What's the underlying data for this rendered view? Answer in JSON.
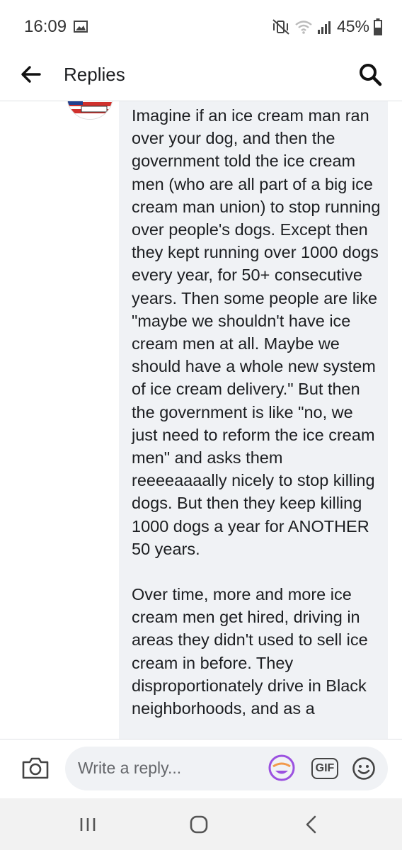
{
  "status_bar": {
    "time": "16:09",
    "battery": "45%",
    "icons": [
      "gallery-icon",
      "mute-vibrate-icon",
      "wifi-icon",
      "signal-icon",
      "battery-icon"
    ]
  },
  "header": {
    "title": "Replies",
    "back_icon": "arrow-left-icon",
    "search_icon": "search-icon"
  },
  "comment": {
    "paragraphs": [
      "Imagine if an ice cream man ran over your dog, and then the government told the ice cream men (who are all part of a big ice cream man union) to stop running over people's dogs. Except then they kept running over 1000 dogs every year, for 50+ consecutive years. Then some people are like \"maybe we shouldn't have ice cream men at all. Maybe we should have a whole new system of ice cream delivery.\" But then the government is like \"no, we just need to reform the ice cream men\" and asks them reeeeaaaally nicely to stop killing dogs. But then they keep killing 1000 dogs a year for ANOTHER 50 years.",
      "Over time, more and more ice cream men get hired, driving in areas they didn't used to sell ice cream in before. They disproportionately drive in Black neighborhoods, and as a"
    ]
  },
  "reply_bar": {
    "placeholder": "Write a reply...",
    "gif_label": "GIF"
  },
  "colors": {
    "bubble": "#f0f2f5",
    "accent": "#9b51e0",
    "text": "#1c1e21"
  }
}
